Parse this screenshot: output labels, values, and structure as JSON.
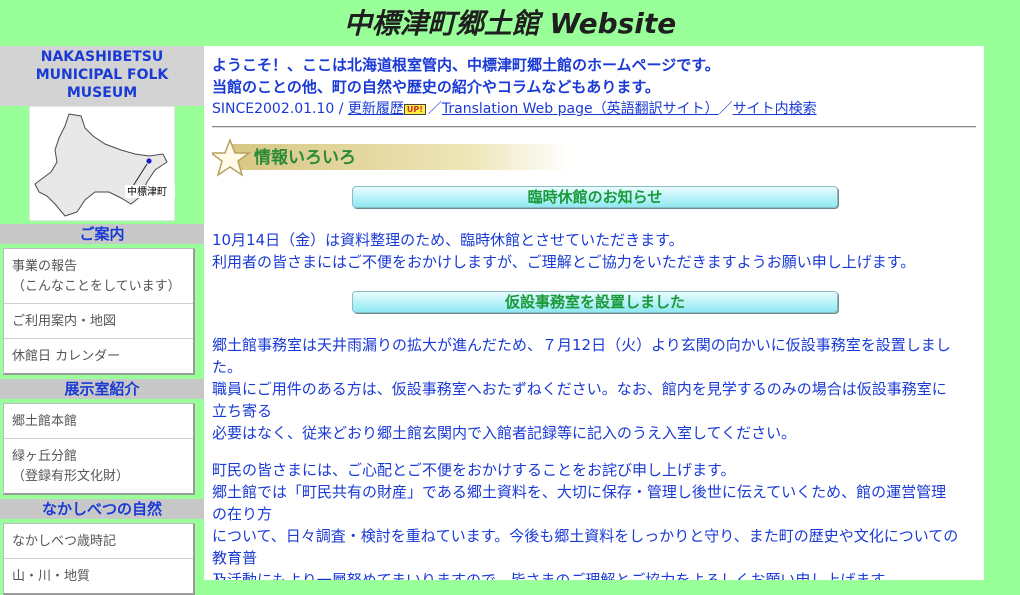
{
  "header": {
    "title": "中標津町郷土館 Website"
  },
  "sidebar": {
    "museum_name": [
      "NAKASHIBETSU",
      "MUNICIPAL FOLK",
      "MUSEUM"
    ],
    "map_label": "中標津町",
    "sections": [
      {
        "title": "ご案内",
        "items": [
          "事業の報告",
          "（こんなことをしています）",
          "ご利用案内・地図",
          "休館日 カレンダー"
        ]
      },
      {
        "title": "展示室紹介",
        "items": [
          "郷土館本館",
          "緑ヶ丘分館",
          "（登録有形文化財）"
        ]
      },
      {
        "title": "なかしべつの自然",
        "items": [
          "なかしべつ歳時記",
          "山・川・地質"
        ]
      }
    ]
  },
  "main": {
    "intro_line1": "ようこそ！、ここは北海道根室管内、中標津町郷土館のホームページです。",
    "intro_line2": "当館のことの他、町の自然や歴史の紹介やコラムなどもあります。",
    "since": "SINCE2002.01.10 /",
    "update_link": "更新履歴",
    "update_badge": "UP!",
    "separator": "／",
    "translation_link": "Translation Web page（英語翻訳サイト）",
    "site_search_link": "サイト内検索",
    "section_heading": "情報いろいろ",
    "notices": [
      {
        "title": "臨時休館のお知らせ",
        "lines": [
          "10月14日（金）は資料整理のため、臨時休館とさせていただきます。",
          "利用者の皆さまにはご不便をおかけしますが、ご理解とご協力をいただきますようお願い申し上げます。"
        ]
      },
      {
        "title": "仮設事務室を設置しました",
        "lines": [
          "郷土館事務室は天井雨漏りの拡大が進んだため、７月12日（火）より玄関の向かいに仮設事務室を設置しまし",
          "た。",
          "職員にご用件のある方は、仮設事務室へおたずねください。なお、館内を見学するのみの場合は仮設事務室に",
          "立ち寄る",
          "必要はなく、従来どおり郷土館玄関内で入館者記録等に記入のうえ入室してください。",
          "町民の皆さまには、ご心配とご不便をおかけすることをお詫び申し上げます。",
          "郷土館では「町民共有の財産」である郷土資料を、大切に保存・管理し後世に伝えていくため、館の運営管理",
          "の在り方",
          "について、日々調査・検討を重ねています。今後も郷土資料をしっかりと守り、また町の歴史や文化についての",
          "教育普",
          "及活動にもより一層努めてまいりますので、皆さまのご理解とご協力をよろしくお願い申し上げます。"
        ]
      }
    ]
  }
}
